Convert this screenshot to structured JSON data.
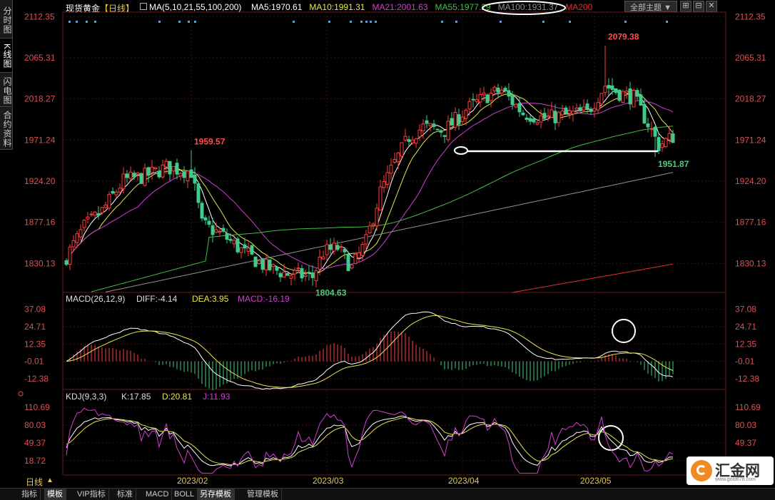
{
  "sidebar": {
    "items": [
      {
        "label": "分时图",
        "active": false
      },
      {
        "label": "K线图",
        "active": true
      },
      {
        "label": "闪电图",
        "active": false
      },
      {
        "label": "合约资料",
        "active": false
      }
    ]
  },
  "header": {
    "title": "现货黄金",
    "period": "【日线】",
    "ma_params": "MA(5,10,21,55,100,200)",
    "ma_values": [
      {
        "label": "MA5:1970.61",
        "color": "#ffffff"
      },
      {
        "label": "MA10:1991.31",
        "color": "#e6e64c"
      },
      {
        "label": "MA21:2001.63",
        "color": "#d040d0"
      },
      {
        "label": "MA55:1977.29",
        "color": "#40c040"
      },
      {
        "label": "MA100:1931.37",
        "color": "#909090"
      },
      {
        "label": "MA200",
        "color": "#e03030"
      }
    ],
    "theme_button": "全部主题",
    "theme_arrow": "▼"
  },
  "bottom_bar": {
    "period_label": "日线",
    "period_arrow": "▲",
    "tabs": [
      {
        "label": "指标",
        "active": false
      },
      {
        "label": "模板",
        "active": true
      },
      {
        "label": "VIP指标",
        "active": false
      },
      {
        "label": "标准",
        "active": false
      },
      {
        "label": "MACD",
        "active": false
      },
      {
        "label": "BOLL",
        "active": false
      },
      {
        "label": "另存模板",
        "active": true
      },
      {
        "label": "管理模板",
        "active": false
      }
    ]
  },
  "logo": {
    "text": "汇金网",
    "sub": "www.gold678.com"
  },
  "chart_data": [
    {
      "type": "candlestick",
      "name": "price",
      "yticks": [
        "2112.35",
        "2065.31",
        "2018.27",
        "1971.24",
        "1924.20",
        "1877.16",
        "1830.13"
      ],
      "ylim": [
        1797,
        2115
      ],
      "xticks": [
        {
          "label": "2023/02",
          "index": 35
        },
        {
          "label": "2023/03",
          "index": 73
        },
        {
          "label": "2023/04",
          "index": 111
        },
        {
          "label": "2023/05",
          "index": 148
        }
      ],
      "annotations": [
        {
          "text": "1959.57",
          "index": 35,
          "value": 1959.57,
          "color": "#ff4d4d",
          "anchor": "high"
        },
        {
          "text": "1804.63",
          "index": 69,
          "value": 1804.63,
          "color": "#4dcc80",
          "anchor": "low"
        },
        {
          "text": "2079.38",
          "index": 151,
          "value": 2079.38,
          "color": "#ff4d4d",
          "anchor": "high"
        },
        {
          "text": "1951.87",
          "index": 165,
          "value": 1951.87,
          "color": "#4dcc80",
          "anchor": "low"
        }
      ],
      "ohlc": [],
      "ma": [
        {
          "name": "MA5",
          "color": "#ffffff"
        },
        {
          "name": "MA10",
          "color": "#e6e64c"
        },
        {
          "name": "MA21",
          "color": "#d040d0"
        },
        {
          "name": "MA55",
          "color": "#40c040"
        },
        {
          "name": "MA100",
          "color": "#909090"
        },
        {
          "name": "MA200",
          "color": "#e03030"
        }
      ]
    },
    {
      "type": "bar+line",
      "name": "macd",
      "legend": [
        {
          "label": "MACD(26,12,9)",
          "color": "#dddddd"
        },
        {
          "label": "DIFF:-4.14",
          "color": "#dddddd"
        },
        {
          "label": "DEA:3.95",
          "color": "#e6e64c"
        },
        {
          "label": "MACD:-16.19",
          "color": "#d040d0"
        }
      ],
      "yticks": [
        "37.08",
        "24.71",
        "12.35",
        "-0.01",
        "-12.38"
      ],
      "ylim": [
        -17,
        40
      ]
    },
    {
      "type": "line",
      "name": "kdj",
      "legend": [
        {
          "label": "KDJ(9,3,3)",
          "color": "#dddddd"
        },
        {
          "label": "K:17.85",
          "color": "#dddddd"
        },
        {
          "label": "D:20.81",
          "color": "#e6e64c"
        },
        {
          "label": "J:11.93",
          "color": "#d040d0"
        }
      ],
      "yticks": [
        "110.69",
        "80.03",
        "49.37",
        "18.72"
      ],
      "ylim": [
        -5,
        122
      ]
    }
  ]
}
